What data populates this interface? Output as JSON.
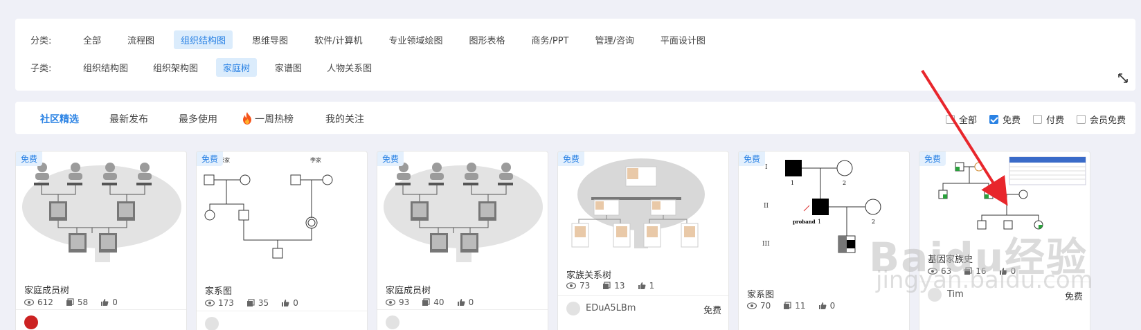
{
  "categories": {
    "label": "分类:",
    "items": [
      "全部",
      "流程图",
      "组织结构图",
      "思维导图",
      "软件/计算机",
      "专业领域绘图",
      "图形表格",
      "商务/PPT",
      "管理/咨询",
      "平面设计图"
    ],
    "active": "组织结构图"
  },
  "subcategories": {
    "label": "子类:",
    "items": [
      "组织结构图",
      "组织架构图",
      "家庭树",
      "家谱图",
      "人物关系图"
    ],
    "active": "家庭树"
  },
  "tabs": [
    "社区精选",
    "最新发布",
    "最多使用",
    "一周热榜",
    "我的关注"
  ],
  "filters": {
    "all": "全部",
    "free": "免费",
    "paid": "付费",
    "member_free": "会员免费"
  },
  "cards": [
    {
      "badge": "免费",
      "title": "家庭成员树",
      "views": "612",
      "copies": "58",
      "likes": "0",
      "author": "",
      "price": ""
    },
    {
      "badge": "免费",
      "title": "家系图",
      "views": "173",
      "copies": "35",
      "likes": "0",
      "author": "",
      "price": ""
    },
    {
      "badge": "免费",
      "title": "家庭成员树",
      "views": "93",
      "copies": "40",
      "likes": "0",
      "author": "",
      "price": ""
    },
    {
      "badge": "免费",
      "title": "家族关系树",
      "views": "73",
      "copies": "13",
      "likes": "1",
      "author": "EDuA5LBm",
      "price": "免费"
    },
    {
      "badge": "免费",
      "title": "家系图",
      "views": "70",
      "copies": "11",
      "likes": "0",
      "author": "",
      "price": ""
    },
    {
      "badge": "免费",
      "title": "基因家族史",
      "views": "63",
      "copies": "16",
      "likes": "0",
      "author": "Tim",
      "price": "免费"
    }
  ],
  "thumb_text": {
    "zhang": "张家",
    "li": "李家",
    "gen1": "I",
    "gen2": "II",
    "gen3": "III",
    "n1": "1",
    "n2": "2",
    "proband": "proband"
  },
  "watermark": {
    "logo": "Baidu经验",
    "url": "jingyan.baidu.com"
  },
  "colors": {
    "accent": "#2a82e4",
    "active_bg": "#dbecfc",
    "arrow": "#e8262c",
    "page_bg": "#eff0f7"
  }
}
